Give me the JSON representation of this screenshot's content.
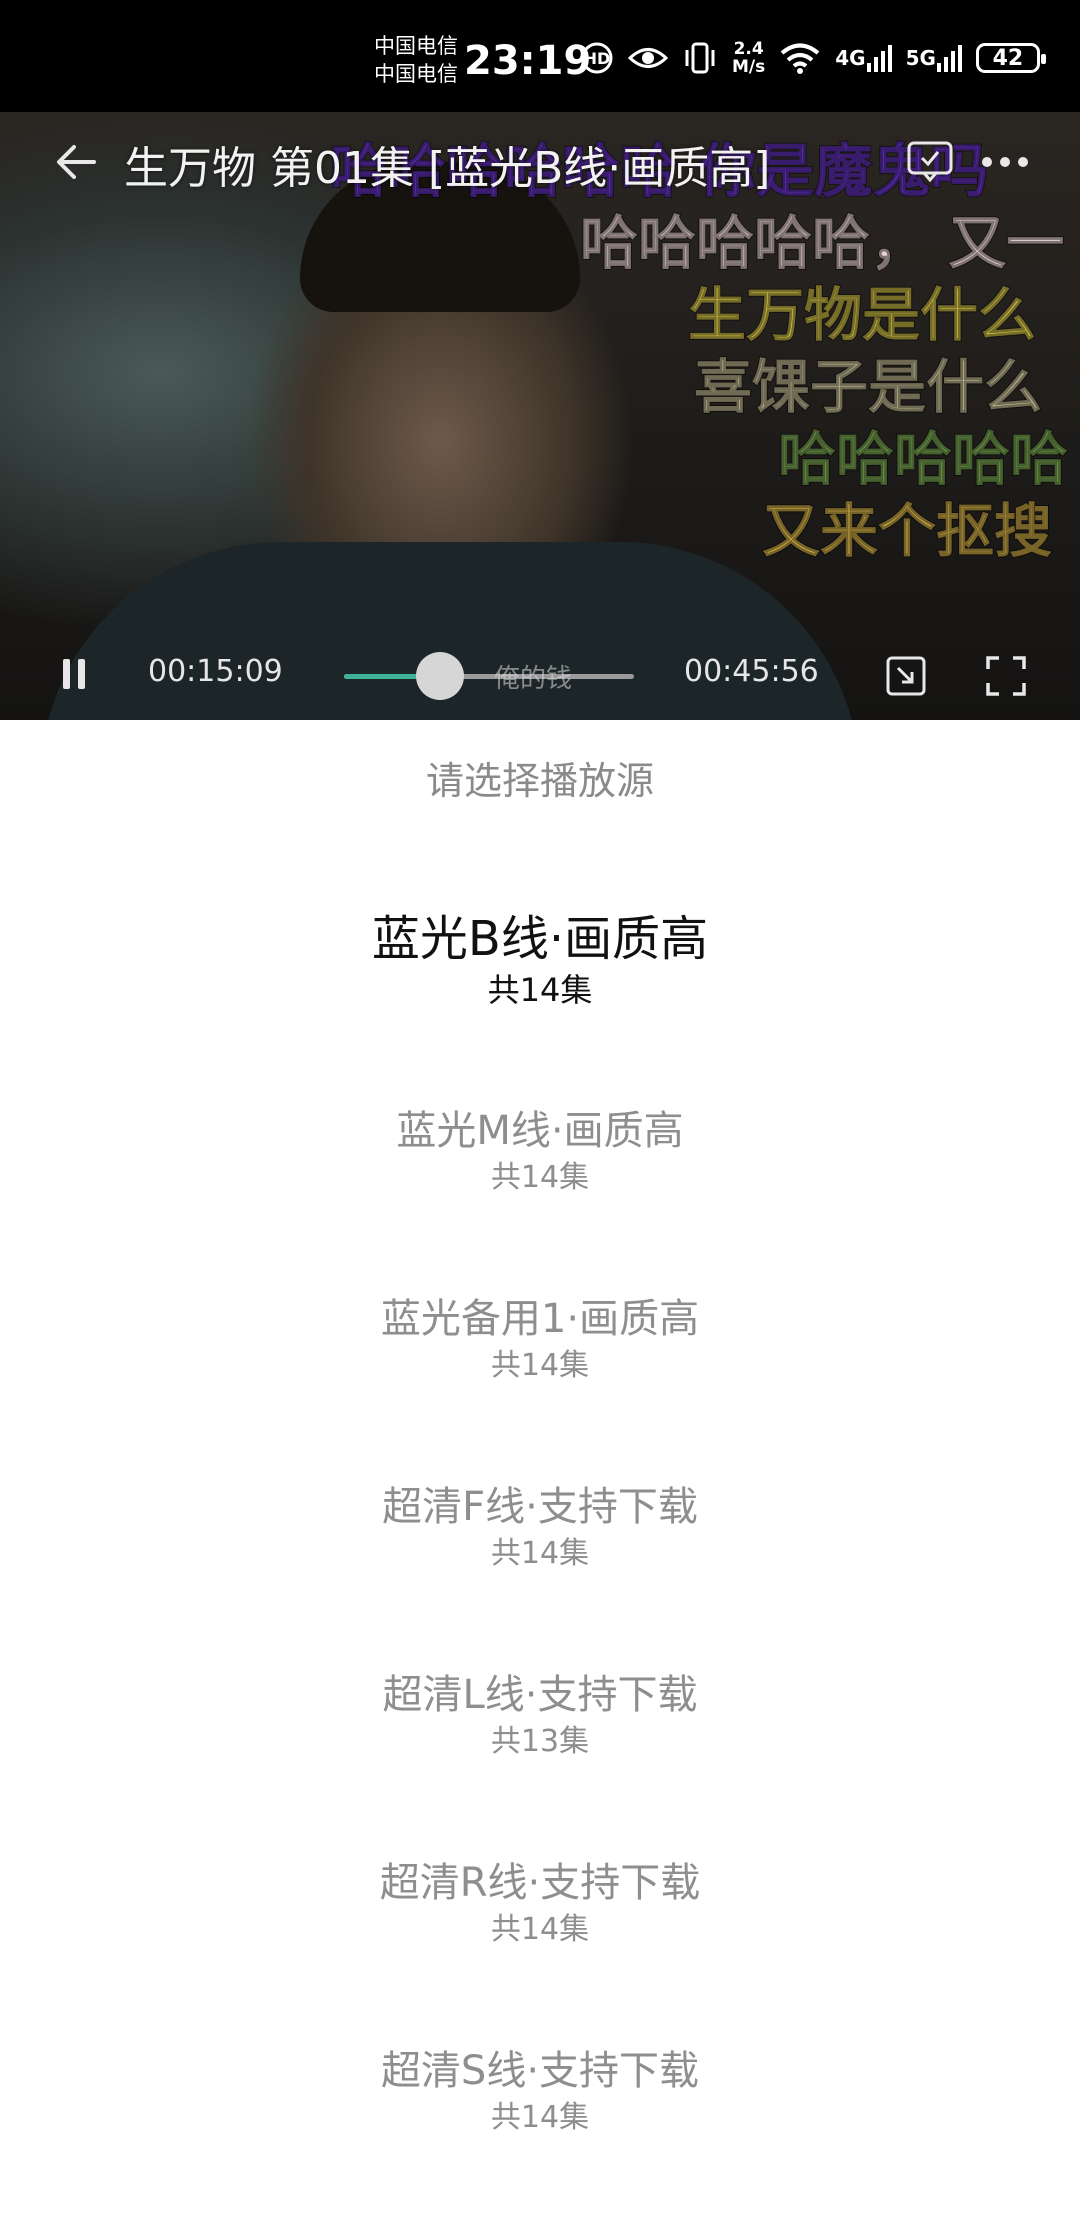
{
  "status_bar": {
    "carrier_1": "中国电信",
    "carrier_2": "中国电信",
    "time": "23:19",
    "net_speed_value": "2.4",
    "net_speed_unit": "M/s",
    "net_1": "4G",
    "net_2": "5G",
    "battery": "42"
  },
  "player": {
    "title": "生万物 第01集 [蓝光B线·画质高]",
    "subtitles": [
      {
        "text": "哈哈哈哈哈哈 你是魔鬼吗",
        "color": "#6a34c9"
      },
      {
        "text": "哈哈哈哈哈， 又一",
        "color": "#e8d2d2"
      },
      {
        "text": "生万物是什么",
        "color": "#d8c64a"
      },
      {
        "text": "喜馃子是什么",
        "color": "#c9c29a"
      },
      {
        "text": "哈哈哈哈哈",
        "color": "#7fae55"
      },
      {
        "text": "又来个抠搜",
        "color": "#d9b54a"
      }
    ],
    "current_time": "00:15:09",
    "total_time": "00:45:56",
    "progress": 0.33,
    "seek_overlay_text": "俺的钱",
    "accent_color": "#3fb39a"
  },
  "sources": {
    "prompt": "请选择播放源",
    "items": [
      {
        "name": "蓝光B线·画质高",
        "count": "共14集",
        "active": true
      },
      {
        "name": "蓝光M线·画质高",
        "count": "共14集",
        "active": false
      },
      {
        "name": "蓝光备用1·画质高",
        "count": "共14集",
        "active": false
      },
      {
        "name": "超清F线·支持下载",
        "count": "共14集",
        "active": false
      },
      {
        "name": "超清L线·支持下载",
        "count": "共13集",
        "active": false
      },
      {
        "name": "超清R线·支持下载",
        "count": "共14集",
        "active": false
      },
      {
        "name": "超清S线·支持下载",
        "count": "共14集",
        "active": false
      }
    ]
  }
}
